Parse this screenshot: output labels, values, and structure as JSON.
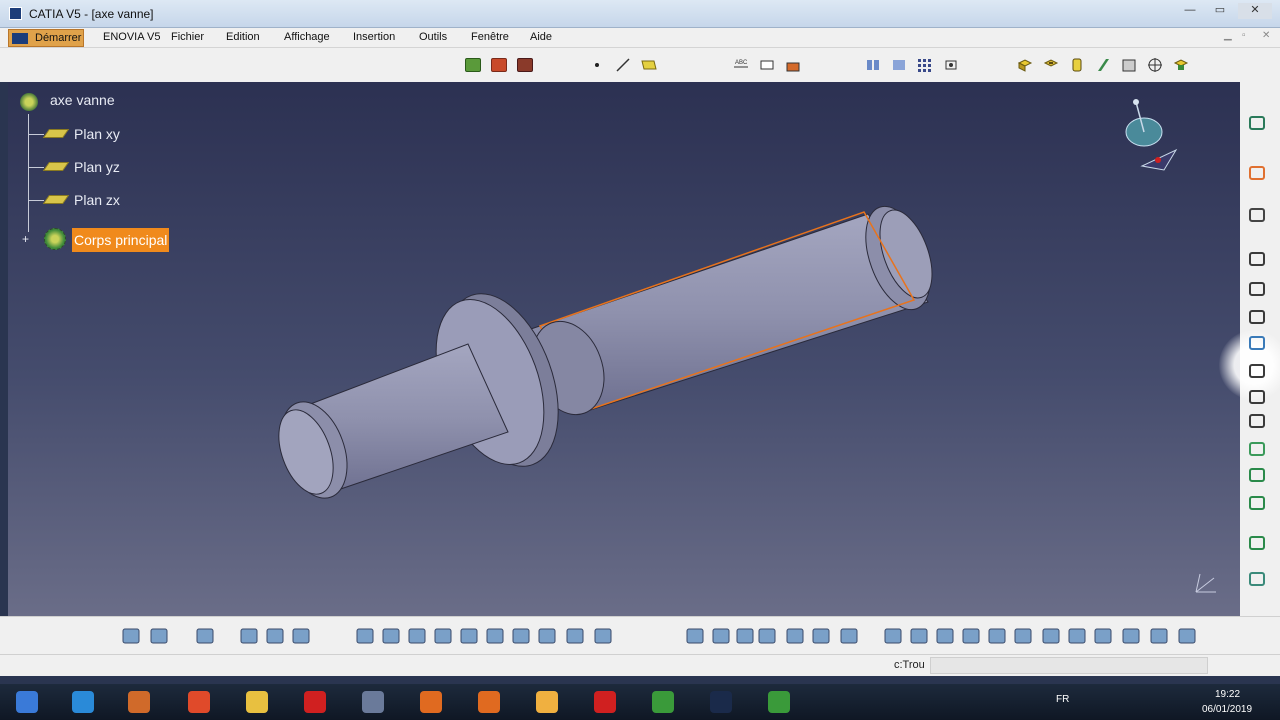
{
  "window": {
    "title": "CATIA V5 - [axe vanne]",
    "minimize": "—",
    "maximize": "▭",
    "close": "✕"
  },
  "menu": {
    "start": "Démarrer",
    "items": [
      "ENOVIA V5",
      "Fichier",
      "Edition",
      "Affichage",
      "Insertion",
      "Outils",
      "Fenêtre",
      "Aide"
    ]
  },
  "tree": {
    "root": "axe vanne",
    "planes": [
      "Plan xy",
      "Plan yz",
      "Plan zx"
    ],
    "expander": "+",
    "body": "Corps principal"
  },
  "status": {
    "label": "c:Trou",
    "input_value": ""
  },
  "taskbar": {
    "language": "FR",
    "time": "19:22",
    "date": "06/01/2019"
  },
  "colors": {
    "accent_selection": "#f08a1c",
    "viewport_top": "#2c3152",
    "viewport_bottom": "#6a6d88",
    "part_fill": "#8f91ad",
    "edge_highlight": "#e8731c"
  },
  "icons": {
    "top_toolbar": [
      "sketch-group-icon",
      "sketch-group-icon",
      "sketch-group-icon",
      "point-icon",
      "line-icon",
      "plane-icon",
      "measure-icon",
      "annotation-icon",
      "apply-material-icon",
      "constraints-icon",
      "dimension-icon",
      "grid-icon",
      "snap-icon",
      "pad-icon",
      "pocket-icon",
      "shaft-icon",
      "groove-icon",
      "hole-icon",
      "rib-icon",
      "slot-icon"
    ],
    "right_toolbar": [
      "gear-icon",
      "select-arrow-icon",
      "sketcher-icon",
      "pad-icon",
      "pocket-icon",
      "shaft-icon",
      "groove-icon",
      "hole-icon",
      "rib-icon",
      "slot-icon",
      "stiffener-icon",
      "solid-combine-icon",
      "multi-section-icon",
      "removed-multi-section-icon",
      "layer-icon"
    ],
    "bottom_toolbar": [
      "apply-material-icon",
      "catalog-icon",
      "fit-all-icon",
      "pan-icon",
      "rotate-icon",
      "zoom-in-icon",
      "new-icon",
      "open-icon",
      "save-icon",
      "print-icon",
      "cut-icon",
      "copy-icon",
      "paste-icon",
      "undo-icon",
      "redo-icon",
      "whats-this-icon",
      "formula-icon",
      "knowledge-icon",
      "law-icon",
      "table-icon",
      "parameter-icon",
      "catalog-browser-icon",
      "fly-mode-icon",
      "fit-all-in-icon",
      "pan-icon",
      "rotate-icon",
      "zoom-in-icon",
      "zoom-out-icon",
      "normal-view-icon",
      "iso-view-icon",
      "quick-view-icon",
      "shading-icon",
      "hide-show-icon",
      "swap-visible-space-icon",
      "catia-logo-icon"
    ],
    "taskbar": [
      "windows-start-icon",
      "internet-explorer-icon",
      "media-player-icon",
      "chrome-icon",
      "file-explorer-icon",
      "opera-icon",
      "notepad-icon",
      "firefox-icon",
      "firefox-icon",
      "chrome-canary-icon",
      "acrobat-icon",
      "camtasia-icon",
      "catia-icon",
      "camtasia-icon"
    ]
  }
}
